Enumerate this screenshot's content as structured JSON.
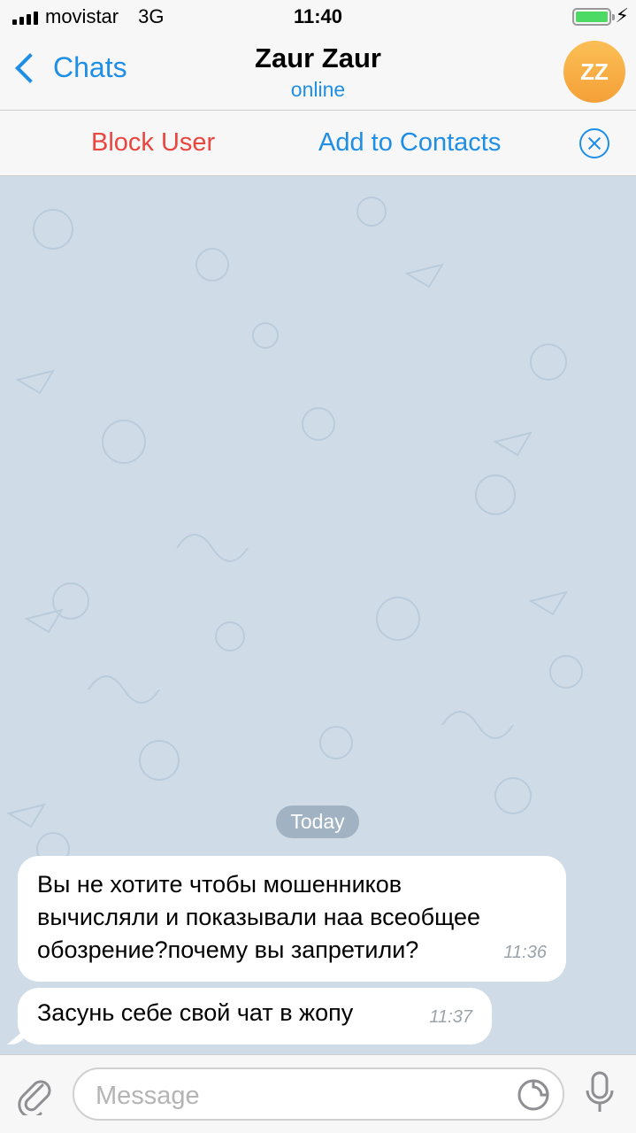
{
  "status_bar": {
    "carrier": "movistar",
    "network": "3G",
    "time": "11:40",
    "battery_level": 1.0
  },
  "nav": {
    "back_label": "Chats",
    "title": "Zaur Zaur",
    "subtitle": "online",
    "avatar_initials": "ZZ",
    "avatar_color": "#f7a33a"
  },
  "actions": {
    "block_label": "Block User",
    "add_label": "Add to Contacts",
    "block_color": "#e9463f",
    "accent_color": "#1f8ee5"
  },
  "chat": {
    "date_label": "Today",
    "messages": [
      {
        "lines": [
          "Вы не хотите чтобы мошенников",
          "вычисляли и показывали наа всеобщее",
          "обозрение?почему вы запретили?"
        ],
        "time": "11:36"
      },
      {
        "lines": [
          "Засунь себе свой чат в жопу"
        ],
        "time": "11:37"
      }
    ]
  },
  "composer": {
    "placeholder": "Message",
    "value": ""
  },
  "icons": [
    "chevron-left-icon",
    "close-circle-icon",
    "paperclip-icon",
    "sticker-icon",
    "microphone-icon",
    "battery-icon",
    "signal-icon",
    "bolt-icon"
  ]
}
